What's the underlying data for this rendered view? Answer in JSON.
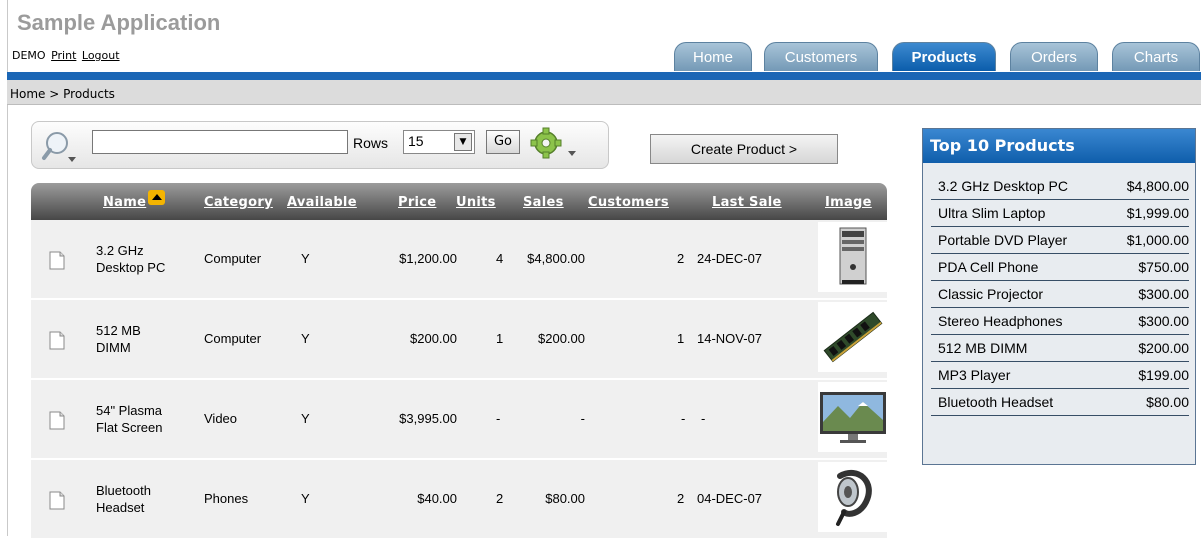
{
  "app": {
    "title": "Sample Application"
  },
  "user": {
    "name": "DEMO",
    "print_label": "Print",
    "logout_label": "Logout"
  },
  "tabs": [
    {
      "label": "Home",
      "active": false
    },
    {
      "label": "Customers",
      "active": false
    },
    {
      "label": "Products",
      "active": true
    },
    {
      "label": "Orders",
      "active": false
    },
    {
      "label": "Charts",
      "active": false
    }
  ],
  "breadcrumb": "Home > Products",
  "search": {
    "value": "",
    "rows_label": "Rows",
    "rows_value": "15",
    "go_label": "Go",
    "create_label": "Create Product >"
  },
  "table": {
    "headers": [
      "Name",
      "Category",
      "Available",
      "Price",
      "Units",
      "Sales",
      "Customers",
      "Last Sale",
      "Image"
    ],
    "rows": [
      {
        "name_line1": "3.2 GHz",
        "name_line2": "Desktop PC",
        "category": "Computer",
        "available": "Y",
        "price": "$1,200.00",
        "units": "4",
        "sales": "$4,800.00",
        "customers": "2",
        "last_sale": "24-DEC-07",
        "image": "desktop-pc-image"
      },
      {
        "name_line1": "512 MB",
        "name_line2": "DIMM",
        "category": "Computer",
        "available": "Y",
        "price": "$200.00",
        "units": "1",
        "sales": "$200.00",
        "customers": "1",
        "last_sale": "14-NOV-07",
        "image": "memory-module-image"
      },
      {
        "name_line1": "54\" Plasma",
        "name_line2": "Flat Screen",
        "category": "Video",
        "available": "Y",
        "price": "$3,995.00",
        "units": "-",
        "sales": "-",
        "customers": "-",
        "last_sale": "-",
        "image": "plasma-screen-image"
      },
      {
        "name_line1": "Bluetooth",
        "name_line2": "Headset",
        "category": "Phones",
        "available": "Y",
        "price": "$40.00",
        "units": "2",
        "sales": "$80.00",
        "customers": "2",
        "last_sale": "04-DEC-07",
        "image": "headset-image"
      }
    ]
  },
  "top10": {
    "title": "Top 10 Products",
    "items": [
      {
        "name": "3.2 GHz Desktop PC",
        "value": "$4,800.00"
      },
      {
        "name": "Ultra Slim Laptop",
        "value": "$1,999.00"
      },
      {
        "name": "Portable DVD Player",
        "value": "$1,000.00"
      },
      {
        "name": "PDA Cell Phone",
        "value": "$750.00"
      },
      {
        "name": "Classic Projector",
        "value": "$300.00"
      },
      {
        "name": "Stereo Headphones",
        "value": "$300.00"
      },
      {
        "name": "512 MB DIMM",
        "value": "$200.00"
      },
      {
        "name": "MP3 Player",
        "value": "$199.00"
      },
      {
        "name": "Bluetooth Headset",
        "value": "$80.00"
      }
    ]
  }
}
